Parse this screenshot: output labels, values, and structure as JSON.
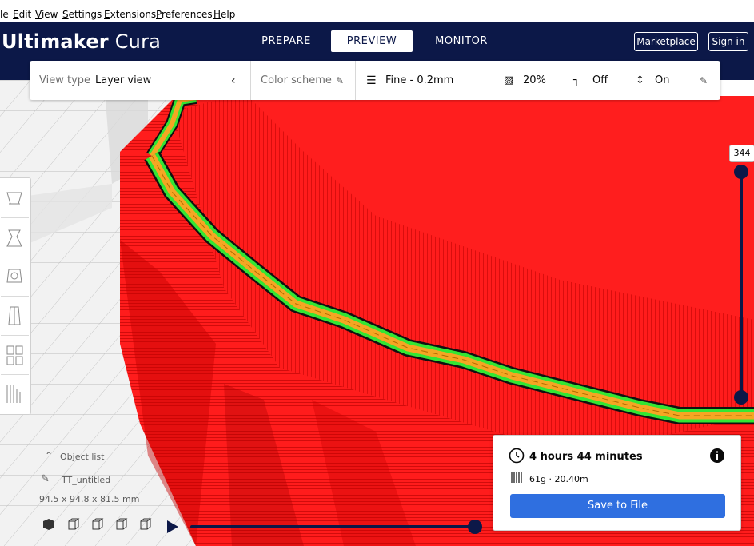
{
  "menu": {
    "items": [
      {
        "prefix": "",
        "mnemonic": "",
        "rest": "le"
      },
      {
        "prefix": "",
        "mnemonic": "E",
        "rest": "dit"
      },
      {
        "prefix": "",
        "mnemonic": "V",
        "rest": "iew"
      },
      {
        "prefix": "",
        "mnemonic": "S",
        "rest": "ettings"
      },
      {
        "prefix": "",
        "mnemonic": "E",
        "rest": "xtensions"
      },
      {
        "prefix": "",
        "mnemonic": "P",
        "rest": "references"
      },
      {
        "prefix": "",
        "mnemonic": "H",
        "rest": "elp"
      }
    ]
  },
  "header": {
    "brand": "Ultimaker",
    "app": "Cura",
    "tabs": [
      "PREPARE",
      "PREVIEW",
      "MONITOR"
    ],
    "active_tab": "PREVIEW",
    "marketplace_label": "Marketplace",
    "signin_label": "Sign in"
  },
  "viewbar": {
    "view_type_label": "View type",
    "view_type_value": "Layer view",
    "color_scheme_label": "Color scheme",
    "profile": "Fine - 0.2mm",
    "infill": "20%",
    "support": "Off",
    "adhesion": "On"
  },
  "layer_slider": {
    "current_layer": "344"
  },
  "object_list": {
    "title": "Object list",
    "object_name": "TT_untitled",
    "dimensions": "94.5 x 94.8 x 81.5 mm"
  },
  "print_info": {
    "time": "4 hours 44 minutes",
    "material": "61g · 20.40m",
    "save_label": "Save to File"
  },
  "colors": {
    "header_bg": "#0c1848",
    "wall_outer": "#ff1a1a",
    "wall_inner": "#33e633",
    "infill": "#f5a623",
    "save_button": "#2f6fe0"
  }
}
